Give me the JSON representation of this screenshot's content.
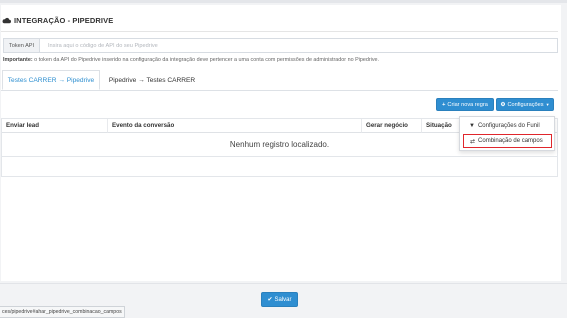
{
  "header": {
    "title": "INTEGRAÇÃO - PIPEDRIVE",
    "icon": "cloud-icon"
  },
  "token": {
    "label": "Token API",
    "placeholder": "Insira aqui o código de API do seu Pipedrive",
    "value": ""
  },
  "note": {
    "strong": "Importante:",
    "text": " o token da API do Pipedrive inserido na configuração da integração deve pertencer a uma conta com permissões de administrador no Pipedrive."
  },
  "tabs": [
    {
      "label": "Testes CARRER → Pipedrive",
      "active": true
    },
    {
      "label": "Pipedrive → Testes CARRER",
      "active": false
    }
  ],
  "actions": {
    "new_rule": "Criar nova regra",
    "new_rule_icon": "plus-icon",
    "settings": "Configurações",
    "settings_icon": "gear-icon"
  },
  "table": {
    "headers": [
      "Enviar lead",
      "Evento da conversão",
      "Gerar negócio",
      "Situação",
      ""
    ],
    "empty_text": "Nenhum registro localizado."
  },
  "dropdown": {
    "items": [
      {
        "label": "Configurações do Funil",
        "icon": "filter-icon"
      },
      {
        "label": "Combinação de campos",
        "icon": "exchange-icon",
        "highlighted": true
      }
    ]
  },
  "footer": {
    "save_label": "Salvar",
    "save_icon": "check-icon"
  },
  "statusbar": {
    "url": "ces/pipedrive#ahar_pipedrive_combinacao_campos"
  },
  "colors": {
    "accent": "#2f8ed1",
    "highlight": "#e0262c",
    "tab_active": "#2e8fd0"
  }
}
